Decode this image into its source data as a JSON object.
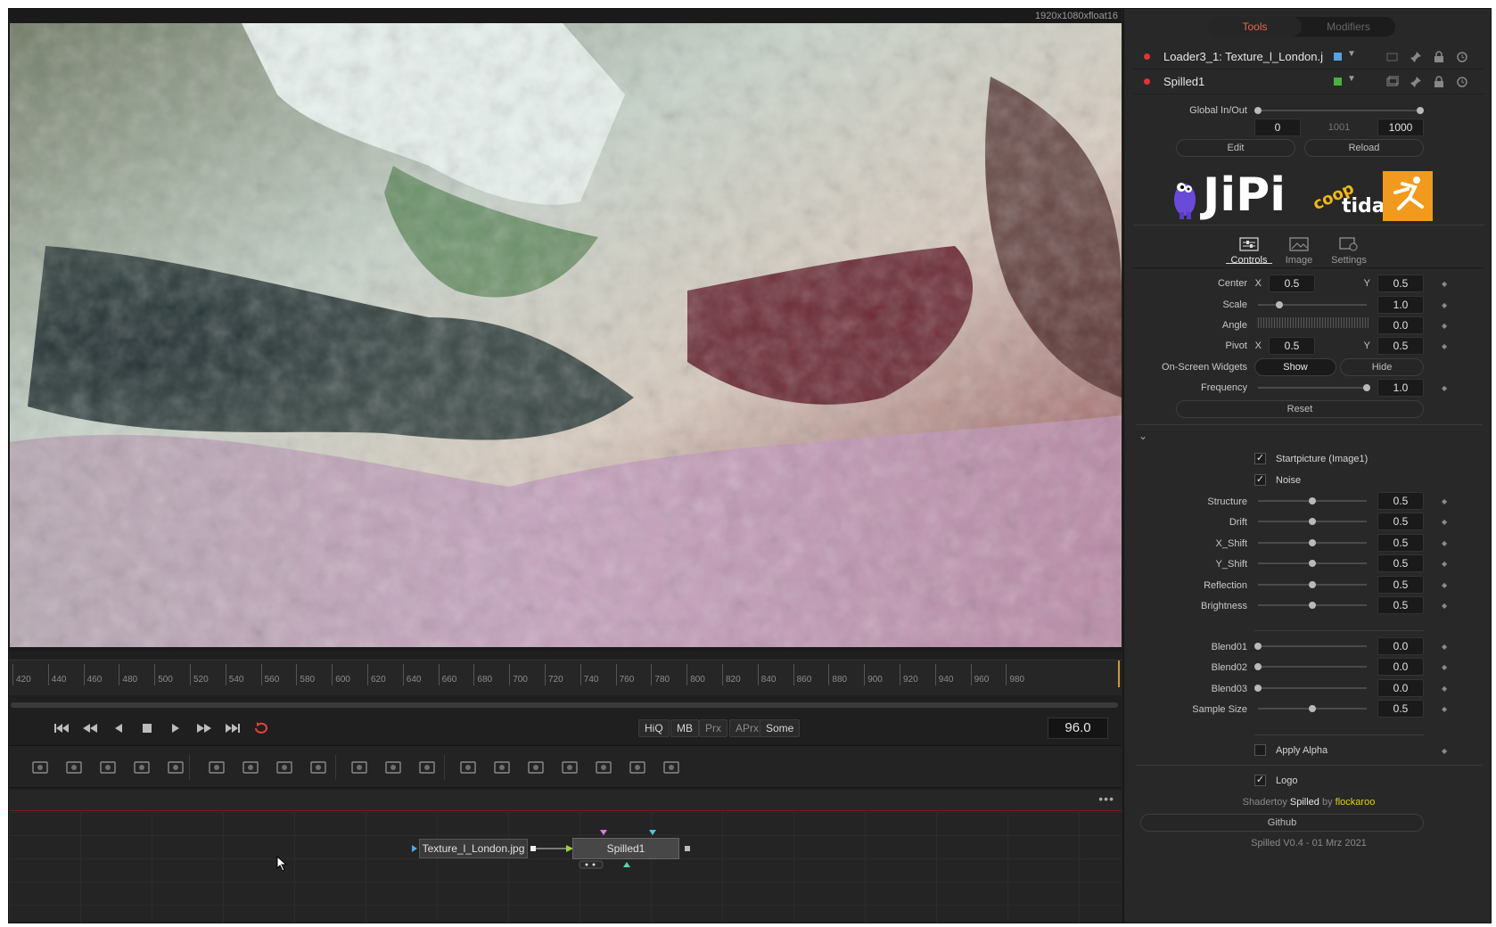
{
  "viewer": {
    "resolution": "1920x1080xfloat16"
  },
  "timeline": {
    "ticks": [
      "420",
      "440",
      "460",
      "480",
      "500",
      "520",
      "540",
      "560",
      "580",
      "600",
      "620",
      "640",
      "660",
      "680",
      "700",
      "720",
      "740",
      "760",
      "780",
      "800",
      "820",
      "840",
      "860",
      "880",
      "900",
      "920",
      "940",
      "960",
      "980"
    ],
    "current_frame": "96.0"
  },
  "transport": {
    "quality": [
      {
        "label": "HiQ",
        "active": true
      },
      {
        "label": "MB",
        "active": true
      },
      {
        "label": "Prx",
        "active": false
      },
      {
        "label": "APrx",
        "active": false
      },
      {
        "label": "Some",
        "active": true
      }
    ]
  },
  "toolbar_icons": [
    "background-icon",
    "paint-icon",
    "mask-paint-icon",
    "transform-icon",
    "merge-icon",
    "rectangle-mask-icon",
    "ellipse-mask-icon",
    "polygon-mask-icon",
    "bspline-mask-icon",
    "particle-emitter-icon",
    "particle-render-icon",
    "particle-merge-icon",
    "image-plane-3d-icon",
    "shape-3d-icon",
    "text-3d-icon",
    "merge-3d-icon",
    "camera-3d-icon",
    "spotlight-3d-icon",
    "renderer-3d-icon"
  ],
  "node_editor": {
    "menu": "•••",
    "nodes": {
      "loader": "Texture_l_London.jpg",
      "spilled": "Spilled1"
    }
  },
  "inspector": {
    "tabs": {
      "tools": "Tools",
      "modifiers": "Modifiers"
    },
    "tool_rows": [
      {
        "name": "Loader3_1: Texture_l_London.j",
        "swatch": "#5aa0e0"
      },
      {
        "name": "Spilled1",
        "swatch": "#4ab040"
      }
    ],
    "global": {
      "label": "Global In/Out",
      "in": "0",
      "mid": "1001",
      "out": "1000",
      "edit": "Edit",
      "reload": "Reload"
    },
    "panel_tabs": {
      "controls": "Controls",
      "image": "Image",
      "settings": "Settings"
    },
    "center": {
      "label": "Center",
      "x_label": "X",
      "x": "0.5",
      "y_label": "Y",
      "y": "0.5"
    },
    "scale": {
      "label": "Scale",
      "value": "1.0",
      "level": 0.2
    },
    "angle": {
      "label": "Angle",
      "value": "0.0"
    },
    "pivot": {
      "label": "Pivot",
      "x_label": "X",
      "x": "0.5",
      "y_label": "Y",
      "y": "0.5"
    },
    "widgets": {
      "label": "On-Screen Widgets",
      "show": "Show",
      "hide": "Hide"
    },
    "frequency": {
      "label": "Frequency",
      "value": "1.0",
      "level": 1.0
    },
    "reset": "Reset",
    "checks": [
      {
        "label": "Startpicture (Image1)",
        "checked": true
      },
      {
        "label": "Noise",
        "checked": true
      }
    ],
    "sliders": [
      {
        "label": "Structure",
        "value": "0.5",
        "level": 0.5
      },
      {
        "label": "Drift",
        "value": "0.5",
        "level": 0.5
      },
      {
        "label": "X_Shift",
        "value": "0.5",
        "level": 0.5
      },
      {
        "label": "Y_Shift",
        "value": "0.5",
        "level": 0.5
      },
      {
        "label": "Reflection",
        "value": "0.5",
        "level": 0.5
      },
      {
        "label": "Brightness",
        "value": "0.5",
        "level": 0.5
      }
    ],
    "blend_sliders": [
      {
        "label": "Blend01",
        "value": "0.0",
        "level": 0.0
      },
      {
        "label": "Blend02",
        "value": "0.0",
        "level": 0.0
      },
      {
        "label": "Blend03",
        "value": "0.0",
        "level": 0.0
      },
      {
        "label": "Sample Size",
        "value": "0.5",
        "level": 0.5
      }
    ],
    "apply_alpha": {
      "label": "Apply Alpha",
      "checked": false
    },
    "logo_check": {
      "label": "Logo",
      "checked": true
    },
    "credit": {
      "prefix": "Shadertoy",
      "title": "Spilled",
      "by": "by",
      "author": "flockaroo"
    },
    "github": "Github",
    "version": "Spilled V0.4 - 01 Mrz 2021"
  },
  "logo": {
    "text": "JiPi",
    "coop": "coop",
    "tida": "tida"
  },
  "colors": {
    "accent": "#e26a4a",
    "node_red": "#e03535",
    "credit_yellow": "#e0d020",
    "playhead": "#d09a2a"
  }
}
